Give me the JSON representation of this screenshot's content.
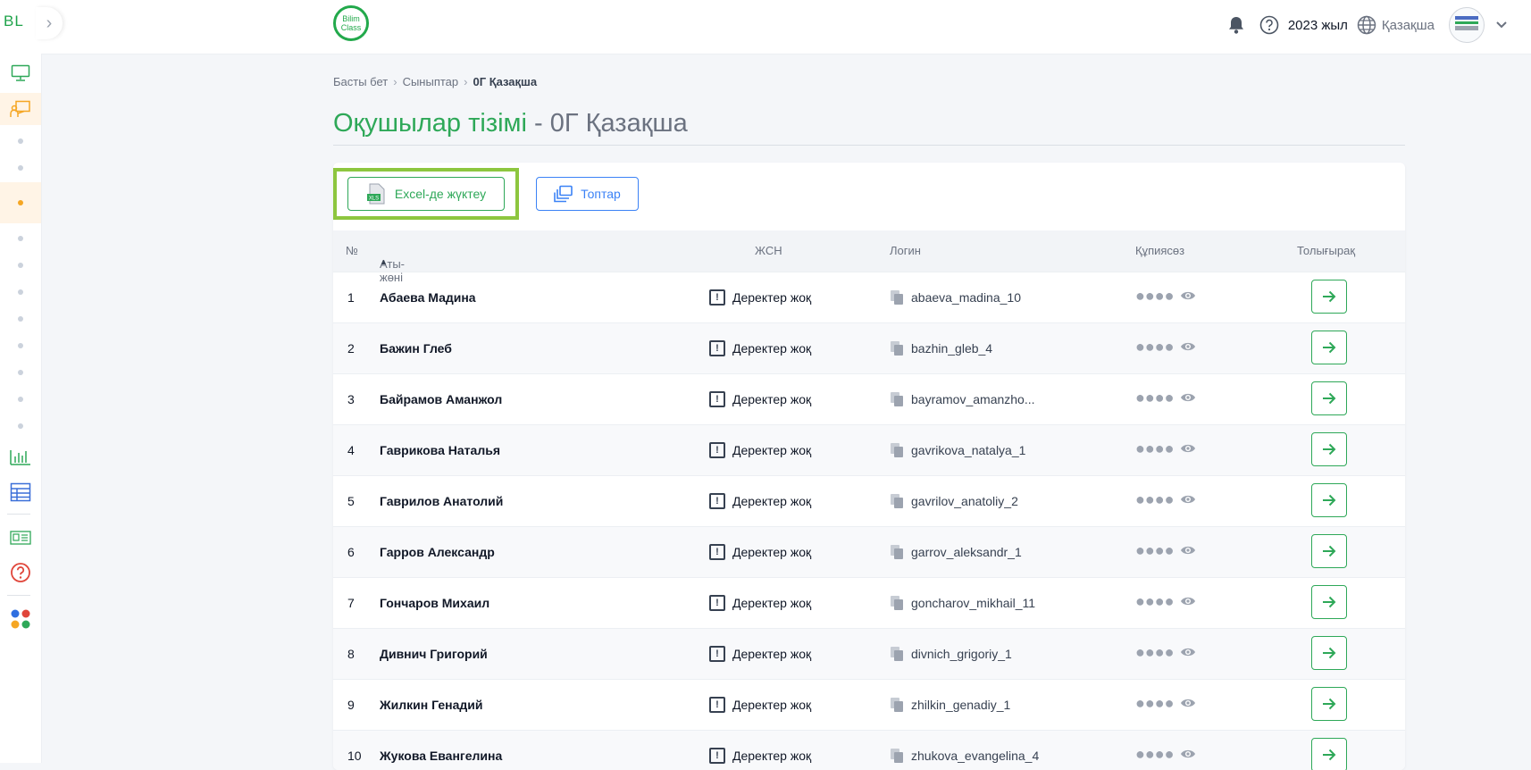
{
  "sidebar": {
    "logo": "BL",
    "toggle": "›"
  },
  "topbar": {
    "brand_line1": "Bilim",
    "brand_line2": "Class",
    "year": "2023 жыл",
    "language": "Қазақша"
  },
  "breadcrumb": {
    "home": "Басты бет",
    "classes": "Сыныптар",
    "current": "0Г Қазақша"
  },
  "title": {
    "main": "Оқушылар тізімі",
    "separator": " - ",
    "class": "0Г Қазақша"
  },
  "actions": {
    "excel_label": "Excel-де жүктеу",
    "excel_icon_text": "XLS",
    "groups_label": "Топтар"
  },
  "table": {
    "headers": {
      "num": "№",
      "name": "Аты-жөні",
      "jsn": "ЖСН",
      "login": "Логин",
      "password": "Құпиясөз",
      "details": "Толығырақ"
    },
    "rows": [
      {
        "num": "1",
        "name": "Абаева Мадина",
        "jsn": "Деректер жоқ",
        "login": "abaeva_madina_10"
      },
      {
        "num": "2",
        "name": "Бажин Глеб",
        "jsn": "Деректер жоқ",
        "login": "bazhin_gleb_4"
      },
      {
        "num": "3",
        "name": "Байрамов Аманжол",
        "jsn": "Деректер жоқ",
        "login": "bayramov_amanzho..."
      },
      {
        "num": "4",
        "name": "Гаврикова Наталья",
        "jsn": "Деректер жоқ",
        "login": "gavrikova_natalya_1"
      },
      {
        "num": "5",
        "name": "Гаврилов Анатолий",
        "jsn": "Деректер жоқ",
        "login": "gavrilov_anatoliy_2"
      },
      {
        "num": "6",
        "name": "Гарров Александр",
        "jsn": "Деректер жоқ",
        "login": "garrov_aleksandr_1"
      },
      {
        "num": "7",
        "name": "Гончаров Михаил",
        "jsn": "Деректер жоқ",
        "login": "goncharov_mikhail_11"
      },
      {
        "num": "8",
        "name": "Дивнич Григорий",
        "jsn": "Деректер жоқ",
        "login": "divnich_grigoriy_1"
      },
      {
        "num": "9",
        "name": "Жилкин Генадий",
        "jsn": "Деректер жоқ",
        "login": "zhilkin_genadiy_1"
      },
      {
        "num": "10",
        "name": "Жукова Евангелина",
        "jsn": "Деректер жоқ",
        "login": "zhukova_evangelina_4"
      }
    ],
    "password_mask": "●●●●",
    "warn_glyph": "!"
  },
  "colors": {
    "accent_green": "#2ea858",
    "accent_blue": "#3b82f6",
    "highlight": "#8dc63f",
    "sidebar_active": "#fff4e6"
  }
}
